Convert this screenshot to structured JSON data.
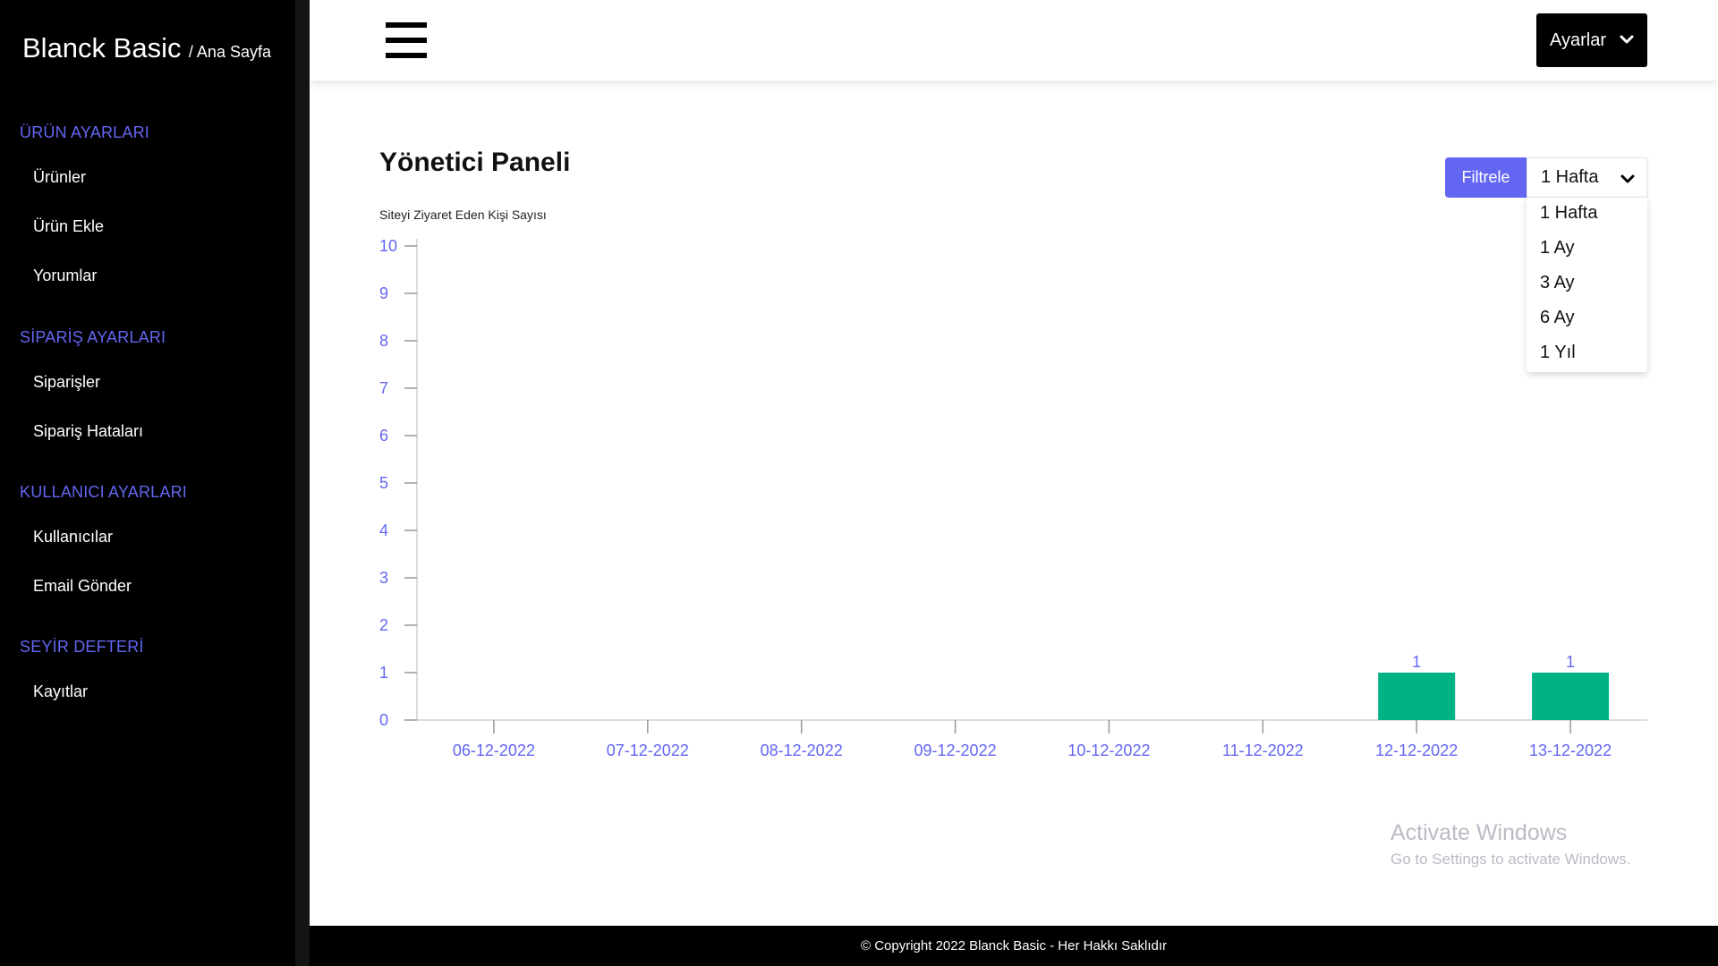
{
  "brand": {
    "name": "Blanck Basic",
    "sub": "/ Ana Sayfa"
  },
  "sidebar": {
    "sections": [
      {
        "title": "ÜRÜN AYARLARI",
        "items": [
          "Ürünler",
          "Ürün Ekle",
          "Yorumlar"
        ]
      },
      {
        "title": "SİPARİŞ AYARLARI",
        "items": [
          "Siparişler",
          "Sipariş Hataları"
        ]
      },
      {
        "title": "KULLANICI AYARLARI",
        "items": [
          "Kullanıcılar",
          "Email Gönder"
        ]
      },
      {
        "title": "SEYİR DEFTERİ",
        "items": [
          "Kayıtlar"
        ]
      }
    ]
  },
  "header": {
    "settings_label": "Ayarlar"
  },
  "main": {
    "title": "Yönetici Paneli",
    "filter_label": "Filtrele",
    "period": {
      "selected": "1 Hafta",
      "options": [
        "1 Hafta",
        "1 Ay",
        "3 Ay",
        "6 Ay",
        "1 Yıl"
      ]
    }
  },
  "chart_data": {
    "type": "bar",
    "title": "Siteyi Ziyaret Eden Kişi Sayısı",
    "xlabel": "",
    "ylabel": "",
    "categories": [
      "06-12-2022",
      "07-12-2022",
      "08-12-2022",
      "09-12-2022",
      "10-12-2022",
      "11-12-2022",
      "12-12-2022",
      "13-12-2022"
    ],
    "values": [
      0,
      0,
      0,
      0,
      0,
      0,
      1,
      1
    ],
    "ylim": [
      0,
      10
    ],
    "yticks": [
      0,
      1,
      2,
      3,
      4,
      5,
      6,
      7,
      8,
      9,
      10
    ],
    "grid": false,
    "bar_color": "#00b386",
    "tick_color": "#6366f1"
  },
  "watermark": {
    "title": "Activate Windows",
    "subtitle": "Go to Settings to activate Windows."
  },
  "footer": {
    "text": "© Copyright 2022 Blanck Basic - Her Hakkı Saklıdır"
  },
  "colors": {
    "accent": "#6366f1",
    "sidebar_bg": "#000000",
    "bar": "#00b386"
  }
}
